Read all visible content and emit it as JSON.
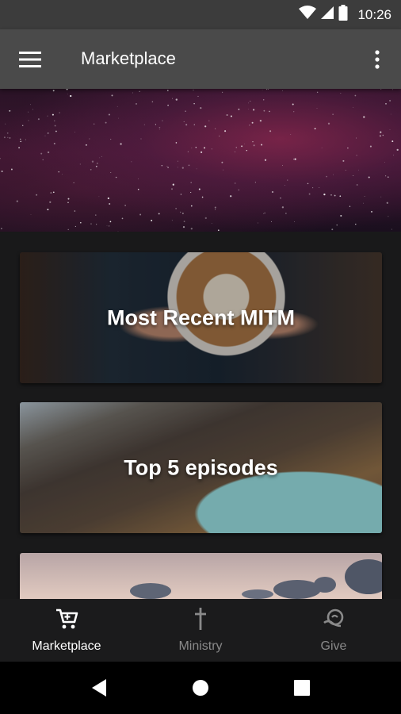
{
  "status_bar": {
    "time": "10:26",
    "icons": [
      "wifi-icon",
      "signal-icon",
      "battery-icon"
    ]
  },
  "app_bar": {
    "title": "Marketplace",
    "menu_icon": "hamburger-menu-icon",
    "more_icon": "more-vertical-icon"
  },
  "cards": [
    {
      "title": "Most Recent MITM"
    },
    {
      "title": "Top 5 episodes"
    },
    {
      "title": ""
    }
  ],
  "bottom_nav": {
    "items": [
      {
        "label": "Marketplace",
        "icon": "cart-icon",
        "active": true
      },
      {
        "label": "Ministry",
        "icon": "cross-icon",
        "active": false
      },
      {
        "label": "Give",
        "icon": "give-icon",
        "active": false
      }
    ]
  },
  "system_nav": {
    "icons": [
      "back-icon",
      "home-icon",
      "recents-icon"
    ]
  },
  "colors": {
    "app_bar": "#4a4a4a",
    "status_bar": "#3c3c3c",
    "background": "#1a1a1b",
    "active_nav": "#ffffff",
    "inactive_nav": "#8a8a8a"
  }
}
